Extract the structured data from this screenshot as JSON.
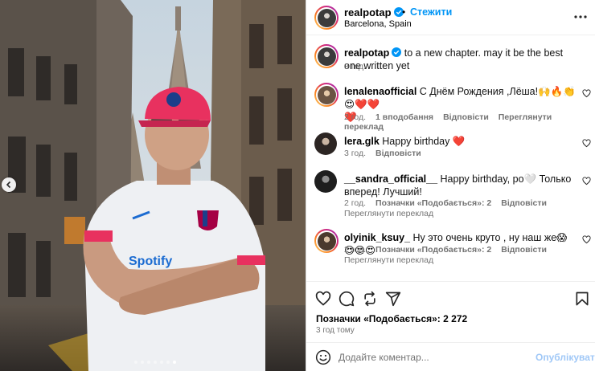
{
  "post": {
    "username": "realpotap",
    "follow_label": "Стежити",
    "separator": "•",
    "location": "Barcelona, Spain",
    "caption_user": "realpotap",
    "caption_text": "to a new chapter. may it be the best one written yet",
    "caption_time": "3 год."
  },
  "comments": [
    {
      "user": "lenalenaofficial",
      "text": "С Днём Рождения ,Лёша!🙌🔥👏😍❤️❤️",
      "line2": "❤️",
      "time": "2 год.",
      "likes": "1 вподобання",
      "reply": "Відповісти",
      "translate": "Переглянути переклад"
    },
    {
      "user": "lera.glk",
      "text": "Happy birthday ❤️",
      "time": "3 год.",
      "reply": "Відповісти"
    },
    {
      "user": "__sandra_official__",
      "text": "Happy birthday, ро🤍 Только вперед! Лучший!",
      "time": "2 год.",
      "likes": "Позначки «Подобається»: 2",
      "reply": "Відповісти",
      "translate": "Переглянути переклад"
    },
    {
      "user": "olyinik_ksuy_",
      "text": "Ну это очень круто , ну наш же😱😍😍😍",
      "time": "2 год.",
      "likes": "Позначки «Подобається»: 2",
      "reply": "Відповісти",
      "translate": "Переглянути переклад"
    }
  ],
  "likes_total": "Позначки «Подобається»: 2 272",
  "posted_ago": "3 год тому",
  "add_comment": {
    "placeholder": "Додайте коментар...",
    "publish_label": "Опублікувати"
  },
  "carousel": {
    "count": 7,
    "active_index": 6
  },
  "colors": {
    "accent": "#0095f6",
    "verified": "#0095f6",
    "heart_red": "#ed4956",
    "cap_pink": "#e8315f"
  },
  "icons": [
    "more-icon",
    "heart-icon",
    "comment-icon",
    "repost-icon",
    "share-icon",
    "bookmark-icon",
    "emoji-icon",
    "chevron-left-icon",
    "verified-icon"
  ]
}
